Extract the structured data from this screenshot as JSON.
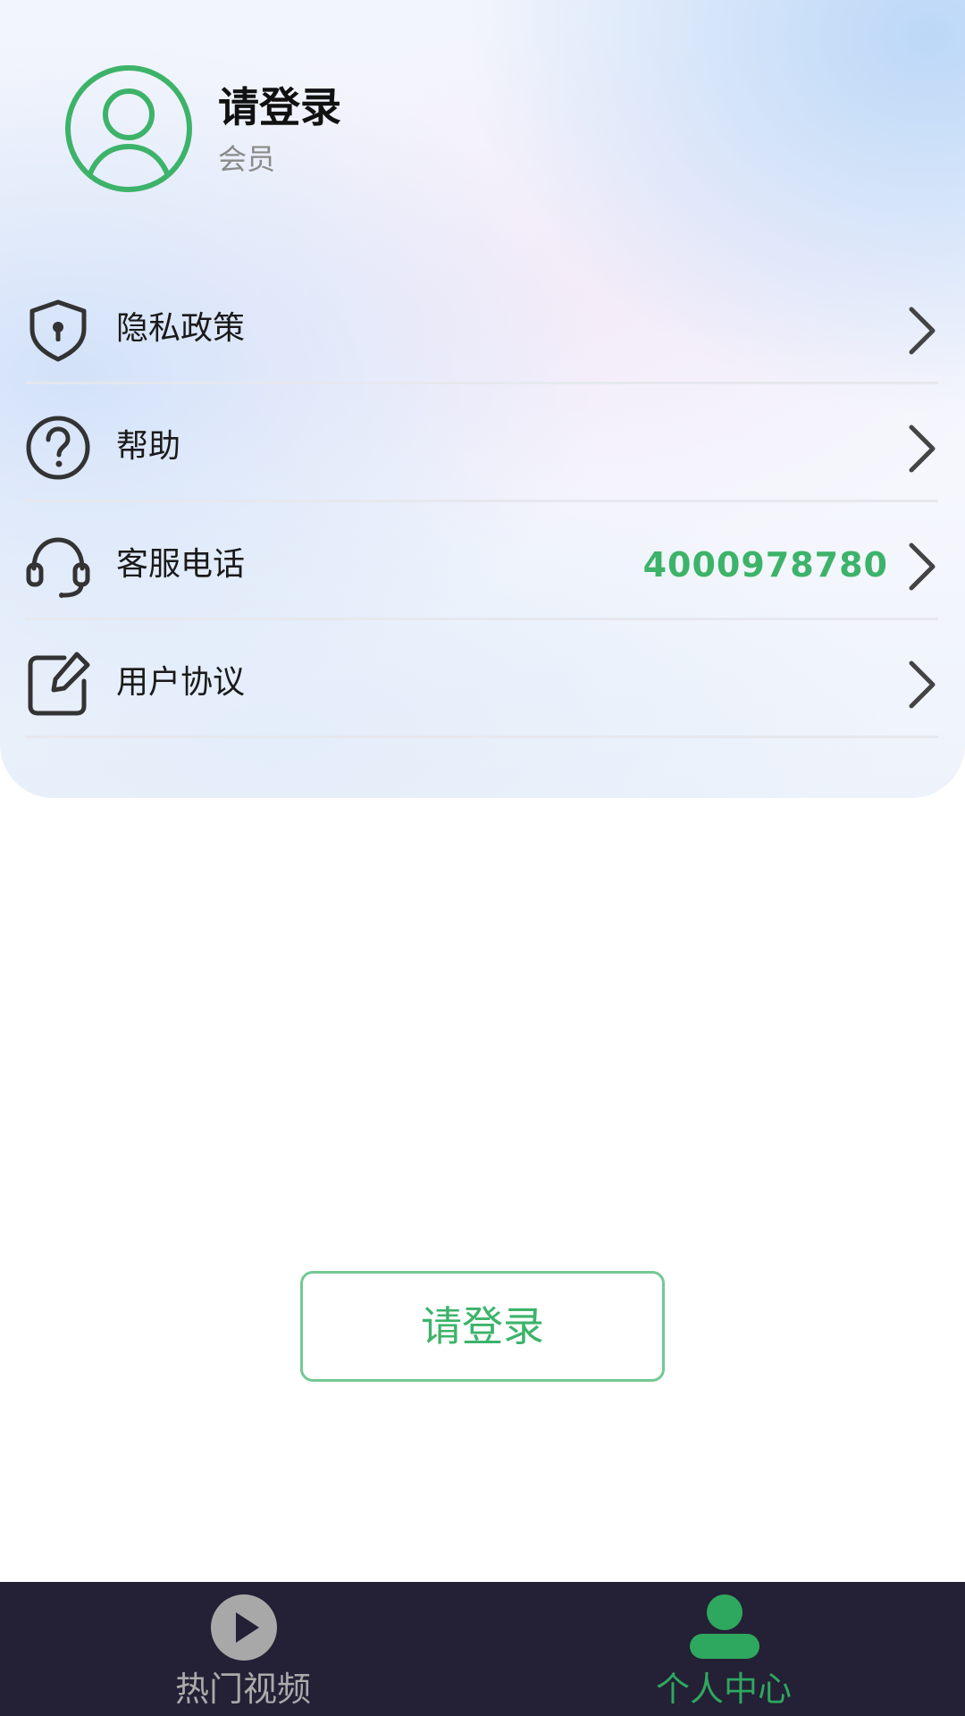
{
  "theme": {
    "accent": "#3db36a",
    "tabbar_bg": "#242036",
    "inactive": "#aaaaaa"
  },
  "profile": {
    "name": "请登录",
    "subtitle": "会员",
    "avatar_icon": "user-avatar-icon"
  },
  "menu": {
    "items": [
      {
        "label": "隐私政策",
        "icon": "shield-icon",
        "value": ""
      },
      {
        "label": "帮助",
        "icon": "question-icon",
        "value": ""
      },
      {
        "label": "客服电话",
        "icon": "headset-icon",
        "value": "4000978780"
      },
      {
        "label": "用户协议",
        "icon": "edit-icon",
        "value": ""
      }
    ]
  },
  "login_button": {
    "label": "请登录"
  },
  "tabbar": {
    "tabs": [
      {
        "label": "热门视频",
        "icon": "play-icon",
        "active": false
      },
      {
        "label": "个人中心",
        "icon": "person-icon",
        "active": true
      }
    ]
  }
}
